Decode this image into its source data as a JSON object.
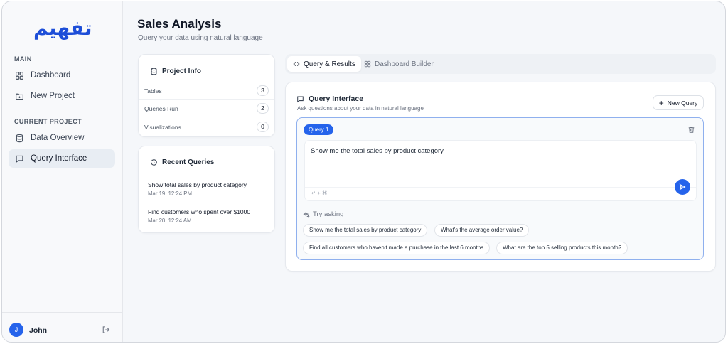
{
  "logo_text": "تفهيم",
  "sidebar": {
    "main_label": "MAIN",
    "items_main": [
      {
        "label": "Dashboard",
        "icon": "grid-icon"
      },
      {
        "label": "New Project",
        "icon": "folder-plus-icon"
      }
    ],
    "current_label": "CURRENT PROJECT",
    "items_project": [
      {
        "label": "Data Overview",
        "icon": "database-icon"
      },
      {
        "label": "Query Interface",
        "icon": "message-icon"
      }
    ],
    "user": {
      "initial": "J",
      "name": "John"
    }
  },
  "header": {
    "title": "Sales Analysis",
    "subtitle": "Query your data using natural language"
  },
  "project_info": {
    "title": "Project Info",
    "stats": [
      {
        "label": "Tables",
        "value": "3"
      },
      {
        "label": "Queries Run",
        "value": "2"
      },
      {
        "label": "Visualizations",
        "value": "0"
      }
    ]
  },
  "recent_queries": {
    "title": "Recent Queries",
    "items": [
      {
        "query": "Show total sales by product category",
        "date": "Mar 19, 12:24 PM"
      },
      {
        "query": "Find customers who spent over $1000",
        "date": "Mar 20, 12:24 AM"
      }
    ]
  },
  "tabs": [
    {
      "label": "Query & Results",
      "active": true
    },
    {
      "label": "Dashboard Builder",
      "active": false
    }
  ],
  "query_interface": {
    "title": "Query Interface",
    "subtitle": "Ask questions about your data in natural language",
    "new_query_label": "New Query",
    "query_badge": "Query 1",
    "query_text": "Show me the total sales by product category",
    "shortcut_hint": "↵ + ⌘",
    "try_label": "Try asking",
    "suggestions": [
      "Show me the total sales by product category",
      "What's the average order value?",
      "Find all customers who haven't made a purchase in the last 6 months",
      "What are the top 5 selling products this month?"
    ]
  },
  "colors": {
    "accent": "#2563eb",
    "active_nav_bg": "#e8edf3"
  }
}
